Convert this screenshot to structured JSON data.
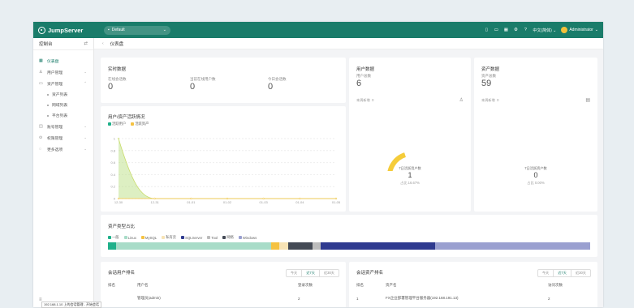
{
  "app": {
    "brand": "JumpServer",
    "org": "Default"
  },
  "topbar": {
    "language": "中文(简体)",
    "user": "Administrator"
  },
  "sidebar": {
    "header": "控制台",
    "items": [
      {
        "label": "仪表盘",
        "icon": "dashboard-icon",
        "active": true
      },
      {
        "label": "用户管理",
        "icon": "user-icon",
        "arrow": true
      },
      {
        "label": "资产管理",
        "icon": "asset-icon",
        "arrow": true,
        "expanded": true
      },
      {
        "label": "资产列表",
        "sub": true
      },
      {
        "label": "网域列表",
        "sub": true
      },
      {
        "label": "平台列表",
        "sub": true
      },
      {
        "label": "账号管理",
        "icon": "account-icon",
        "arrow": true
      },
      {
        "label": "权限管理",
        "icon": "permission-icon",
        "arrow": true
      },
      {
        "label": "更多选项",
        "icon": "more-icon",
        "arrow": true
      }
    ]
  },
  "breadcrumb": {
    "title": "仪表盘"
  },
  "realtime": {
    "title": "实时数据",
    "stats": [
      {
        "label": "在线会话数",
        "value": "0"
      },
      {
        "label": "当前在线用户数",
        "value": "0"
      },
      {
        "label": "今日会话数",
        "value": "0"
      }
    ]
  },
  "user_data": {
    "title": "用户数据",
    "total_label": "用户总数",
    "total": "6",
    "weekly_label": "本周新增",
    "weekly": "0",
    "active_label": "7日活跃用户数",
    "active_value": "1",
    "active_pct": "占比 16.67%"
  },
  "asset_data": {
    "title": "资产数据",
    "total_label": "资产总数",
    "total": "59",
    "weekly_label": "本周新增",
    "weekly": "0",
    "active_label": "7日活跃资产数",
    "active_value": "0",
    "active_pct": "占比 0.00%"
  },
  "trend": {
    "title": "用户/资产活跃情况",
    "legend": [
      {
        "name": "活跃用户",
        "color": "#1fb08a"
      },
      {
        "name": "活跃资产",
        "color": "#f5c242"
      }
    ],
    "yticks": [
      "0",
      "0.2",
      "0.4",
      "0.6",
      "0.8",
      "1"
    ],
    "xticks": [
      "12-30",
      "12-31",
      "01-01",
      "01-02",
      "01-03",
      "01-04",
      "01-05"
    ]
  },
  "chart_data": {
    "type": "area",
    "categories": [
      "12-30",
      "12-31",
      "01-01",
      "01-02",
      "01-03",
      "01-04",
      "01-05"
    ],
    "series": [
      {
        "name": "活跃用户",
        "values": [
          1,
          0,
          0,
          0,
          0,
          0,
          0
        ]
      },
      {
        "name": "活跃资产",
        "values": [
          0,
          0,
          0,
          0,
          0,
          0,
          0
        ]
      }
    ],
    "ylim": [
      0,
      1
    ]
  },
  "asset_types": {
    "title": "资产类型占比",
    "legend": [
      {
        "name": "一般",
        "color": "#1fb08a"
      },
      {
        "name": "Linux",
        "color": "#a8dcc8"
      },
      {
        "name": "MySQL",
        "color": "#f5c242"
      },
      {
        "name": "私有云",
        "color": "#f7e3b5"
      },
      {
        "name": "SQLServer",
        "color": "#2f3a8f"
      },
      {
        "name": "Tool",
        "color": "#bcbcbc"
      },
      {
        "name": "网络",
        "color": "#444a55"
      },
      {
        "name": "Windows",
        "color": "#9aa0d0"
      }
    ],
    "bar": [
      {
        "color": "#1fb08a",
        "pct": 1.7
      },
      {
        "color": "#a8dcc8",
        "pct": 32.2
      },
      {
        "color": "#f5c242",
        "pct": 1.7
      },
      {
        "color": "#f7e3b5",
        "pct": 1.7
      },
      {
        "color": "#444a55",
        "pct": 5.1
      },
      {
        "color": "#bcbcbc",
        "pct": 1.7
      },
      {
        "color": "#2f3a8f",
        "pct": 23.7
      },
      {
        "color": "#9aa0d0",
        "pct": 32.2
      }
    ]
  },
  "session_users": {
    "title": "会话用户排名",
    "tabs": [
      "今天",
      "近7天",
      "近30天"
    ],
    "columns": [
      "排名",
      "用户名",
      "登录次数"
    ],
    "rows": [
      {
        "rank": "",
        "name": "管理员(admin)",
        "count": "2"
      }
    ]
  },
  "session_assets": {
    "title": "会话资产排名",
    "tabs": [
      "今天",
      "近7天",
      "近30天"
    ],
    "columns": [
      "排名",
      "资产名",
      "访问次数"
    ],
    "rows": [
      {
        "rank": "1",
        "name": "FX企业部署管理平台服务器(192.168.191.13)",
        "count": "2"
      }
    ]
  },
  "tooltip": {
    "text": "192.168.1.10 上的会话管理 - 开始会话"
  }
}
